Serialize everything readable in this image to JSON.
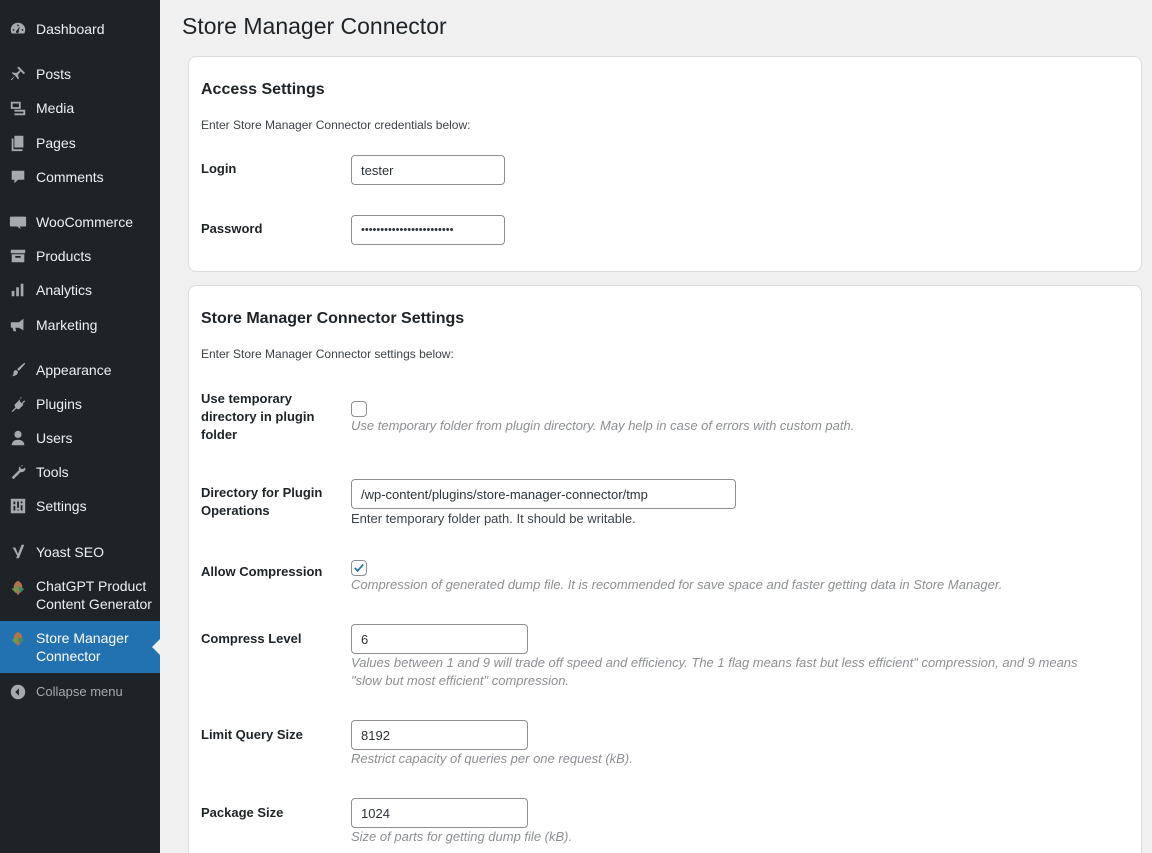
{
  "sidebar": {
    "items": [
      {
        "label": "Dashboard",
        "icon": "dashboard-icon"
      },
      {
        "label": "Posts",
        "icon": "pin-icon"
      },
      {
        "label": "Media",
        "icon": "media-icon"
      },
      {
        "label": "Pages",
        "icon": "pages-icon"
      },
      {
        "label": "Comments",
        "icon": "comment-icon"
      },
      {
        "label": "WooCommerce",
        "icon": "woo-icon"
      },
      {
        "label": "Products",
        "icon": "archive-icon"
      },
      {
        "label": "Analytics",
        "icon": "chart-icon"
      },
      {
        "label": "Marketing",
        "icon": "megaphone-icon"
      },
      {
        "label": "Appearance",
        "icon": "brush-icon"
      },
      {
        "label": "Plugins",
        "icon": "plugin-icon"
      },
      {
        "label": "Users",
        "icon": "user-icon"
      },
      {
        "label": "Tools",
        "icon": "wrench-icon"
      },
      {
        "label": "Settings",
        "icon": "sliders-icon"
      },
      {
        "label": "Yoast SEO",
        "icon": "yoast-icon"
      },
      {
        "label_line1": "ChatGPT Product",
        "label_line2": "Content Generator",
        "icon": "leaf-icon"
      },
      {
        "label_line1": "Store Manager",
        "label_line2": "Connector",
        "icon": "leaf-icon"
      }
    ],
    "collapse_label": "Collapse menu"
  },
  "page": {
    "title": "Store Manager Connector"
  },
  "access": {
    "title": "Access Settings",
    "description": "Enter Store Manager Connector credentials below:",
    "login_label": "Login",
    "login_value": "tester",
    "password_label": "Password",
    "password_value": "••••••••••••••••••••••••"
  },
  "settings": {
    "title": "Store Manager Connector Settings",
    "description": "Enter Store Manager Connector settings below:",
    "temp_dir_label_1": "Use temporary",
    "temp_dir_label_2": "directory in plugin",
    "temp_dir_label_3": "folder",
    "temp_dir_checked": false,
    "temp_dir_help": "Use temporary folder from plugin directory. May help in case of errors with custom path.",
    "dir_label_1": "Directory for Plugin",
    "dir_label_2": "Operations",
    "dir_value": "/wp-content/plugins/store-manager-connector/tmp",
    "dir_help": "Enter temporary folder path. It should be writable.",
    "compression_label": "Allow Compression",
    "compression_checked": true,
    "compression_help": "Compression of generated dump file. It is recommended for save space and faster getting data in Store Manager.",
    "compress_level_label": "Compress Level",
    "compress_level_value": "6",
    "compress_level_help_1": "Values between 1 and 9 will trade off speed and efficiency. The 1 flag means fast but less efficient\" compression, and 9 means",
    "compress_level_help_2": "\"slow but most efficient\" compression.",
    "query_size_label": "Limit Query Size",
    "query_size_value": "8192",
    "query_size_help": "Restrict capacity of queries per one request (kB).",
    "package_size_label": "Package Size",
    "package_size_value": "1024",
    "package_size_help": "Size of parts for getting dump file (kB)."
  },
  "colors": {
    "sidebar_bg": "#1d2327",
    "active_bg": "#2271b1",
    "page_bg": "#f0f0f1",
    "checkbox_check": "#2271b1"
  }
}
